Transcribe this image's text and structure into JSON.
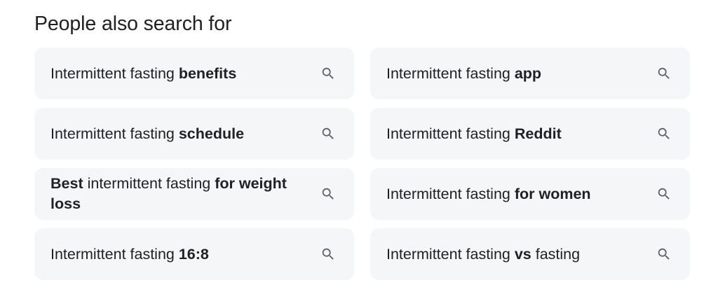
{
  "heading": "People also search for",
  "icon_color": "#5f6368",
  "chip_background": "#f5f6f8",
  "suggestions": [
    {
      "segments": [
        {
          "text": "Intermittent fasting ",
          "bold": false
        },
        {
          "text": "benefits",
          "bold": true
        }
      ],
      "icon": "search-icon"
    },
    {
      "segments": [
        {
          "text": "Intermittent fasting ",
          "bold": false
        },
        {
          "text": "app",
          "bold": true
        }
      ],
      "icon": "search-icon"
    },
    {
      "segments": [
        {
          "text": "Intermittent fasting ",
          "bold": false
        },
        {
          "text": "schedule",
          "bold": true
        }
      ],
      "icon": "search-icon"
    },
    {
      "segments": [
        {
          "text": "Intermittent fasting ",
          "bold": false
        },
        {
          "text": "Reddit",
          "bold": true
        }
      ],
      "icon": "search-icon"
    },
    {
      "segments": [
        {
          "text": "Best",
          "bold": true
        },
        {
          "text": " intermittent fasting ",
          "bold": false
        },
        {
          "text": "for weight loss",
          "bold": true
        }
      ],
      "icon": "search-icon"
    },
    {
      "segments": [
        {
          "text": "Intermittent fasting ",
          "bold": false
        },
        {
          "text": "for women",
          "bold": true
        }
      ],
      "icon": "search-icon"
    },
    {
      "segments": [
        {
          "text": "Intermittent fasting ",
          "bold": false
        },
        {
          "text": "16:8",
          "bold": true
        }
      ],
      "icon": "search-icon"
    },
    {
      "segments": [
        {
          "text": "Intermittent fasting ",
          "bold": false
        },
        {
          "text": "vs",
          "bold": true
        },
        {
          "text": " fasting",
          "bold": false
        }
      ],
      "icon": "search-icon"
    }
  ]
}
